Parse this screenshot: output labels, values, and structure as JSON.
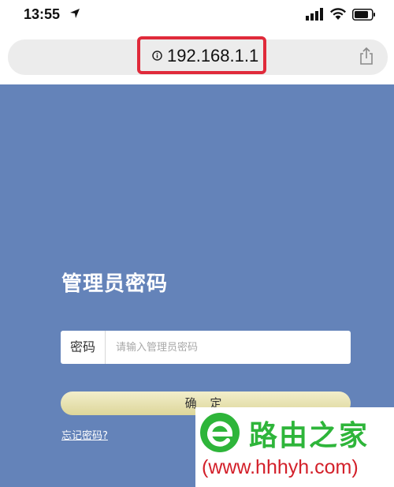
{
  "status_bar": {
    "time": "13:55"
  },
  "address_bar": {
    "url": "192.168.1.1",
    "highlight_color": "#e02a3a"
  },
  "login": {
    "title": "管理员密码",
    "password_label": "密码",
    "password_placeholder": "请输入管理员密码",
    "password_value": "",
    "confirm_button": "确 定",
    "forgot_link": "忘记密码?"
  },
  "watermark": {
    "title": "路由之家",
    "url": "(www.hhhyh.com)"
  },
  "colors": {
    "page_background": "#6483b9",
    "button": "#e8e2b0",
    "watermark_green": "#2eb53a",
    "watermark_red": "#d3202a"
  }
}
